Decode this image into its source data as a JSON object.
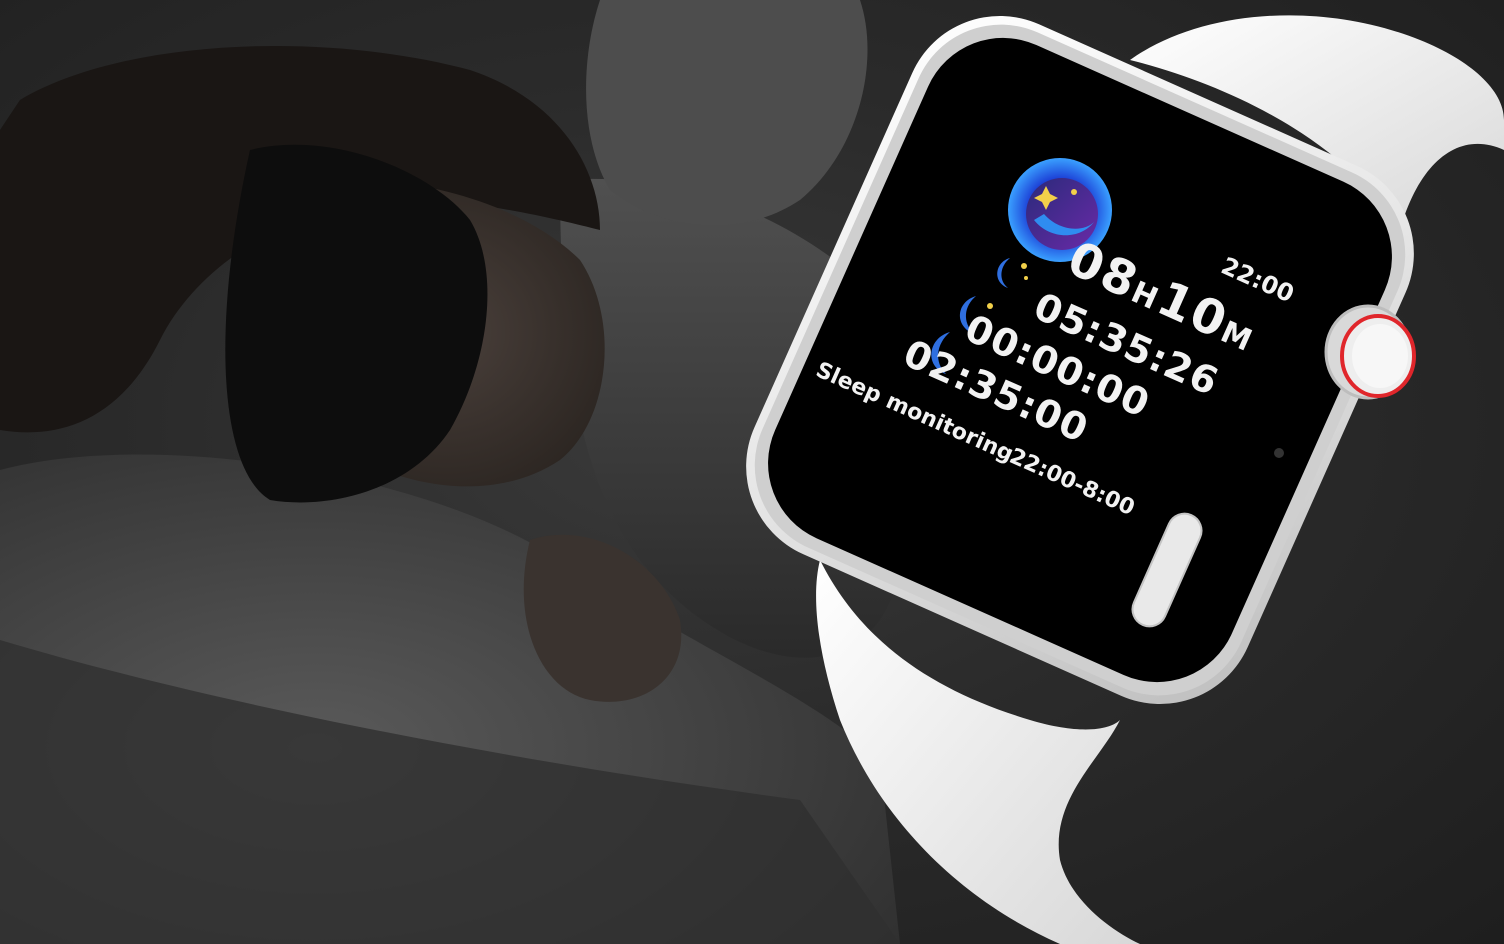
{
  "watch_screen": {
    "clock": "22:00",
    "total_sleep": {
      "hours": "08",
      "hours_unit": "H",
      "minutes": "10",
      "minutes_unit": "M"
    },
    "stages": [
      {
        "icon": "moon-stars-icon",
        "value": "05:35:26"
      },
      {
        "icon": "moon-star-icon",
        "value": "00:00:00"
      },
      {
        "icon": "moon-icon",
        "value": "02:35:00"
      }
    ],
    "footer_label": "Sleep monitoring",
    "footer_range": "22:00-8:00"
  },
  "colors": {
    "screen_bg": "#000000",
    "text": "#f2f2f2",
    "moon_blue": "#2f6fe0",
    "star_yellow": "#f2d04a",
    "crown_ring": "#e0262b",
    "watch_body": "#f4f4f4"
  }
}
